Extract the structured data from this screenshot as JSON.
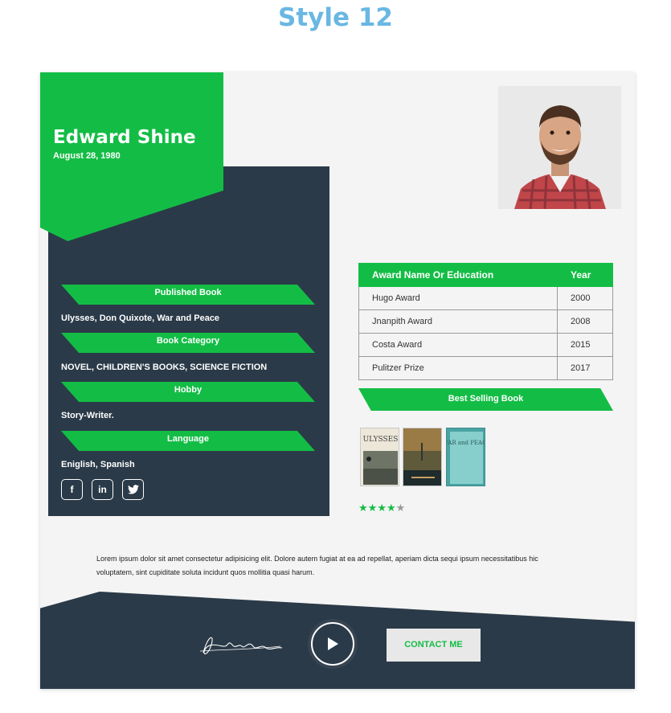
{
  "page": {
    "title": "Style 12"
  },
  "profile": {
    "name": "Edward Shine",
    "dob": "August 28, 1980",
    "photo_alt": "profile-photo"
  },
  "sections": [
    {
      "heading": "Published Book",
      "value": "Ulysses, Don Quixote, War and Peace"
    },
    {
      "heading": "Book Category",
      "value": "NOVEL, CHILDREN'S BOOKS, SCIENCE FICTION"
    },
    {
      "heading": "Hobby",
      "value": "Story-Writer."
    },
    {
      "heading": "Language",
      "value": "Eniglish, Spanish"
    }
  ],
  "social": [
    {
      "icon": "facebook-icon",
      "glyph": "f"
    },
    {
      "icon": "linkedin-icon",
      "glyph": "in"
    },
    {
      "icon": "twitter-icon",
      "glyph": "🐦"
    }
  ],
  "awards": {
    "headers": {
      "name": "Award Name Or Education",
      "year": "Year"
    },
    "rows": [
      {
        "name": "Hugo Award",
        "year": "2000"
      },
      {
        "name": "Jnanpith Award",
        "year": "2008"
      },
      {
        "name": "Costa Award",
        "year": "2015"
      },
      {
        "name": "Pulitzer Prize",
        "year": "2017"
      }
    ]
  },
  "best_selling": {
    "heading": "Best Selling Book",
    "books": [
      {
        "title": "ULYSSES",
        "colors": [
          "#e9e4d6",
          "#585f55"
        ]
      },
      {
        "title": "",
        "colors": [
          "#8b6a3a",
          "#1e2a2a"
        ]
      },
      {
        "title": "WAR and PEACE",
        "colors": [
          "#7fc7c6",
          "#3e8d8c"
        ]
      }
    ],
    "rating": 4,
    "rating_max": 5
  },
  "bio": "Lorem ipsum dolor sit amet consectetur adipisicing elit. Dolore autem fugiat at ea ad repellat, aperiam dicta sequi ipsum necessitatibus hic voluptatem, sint cupiditate soluta incidunt quos mollitia quasi harum.",
  "footer": {
    "signature": "Frank Sinatra",
    "contact_label": "CONTACT ME"
  },
  "colors": {
    "green": "#13bd45",
    "navy": "#2b3a48",
    "title_blue": "#69b7e3"
  }
}
